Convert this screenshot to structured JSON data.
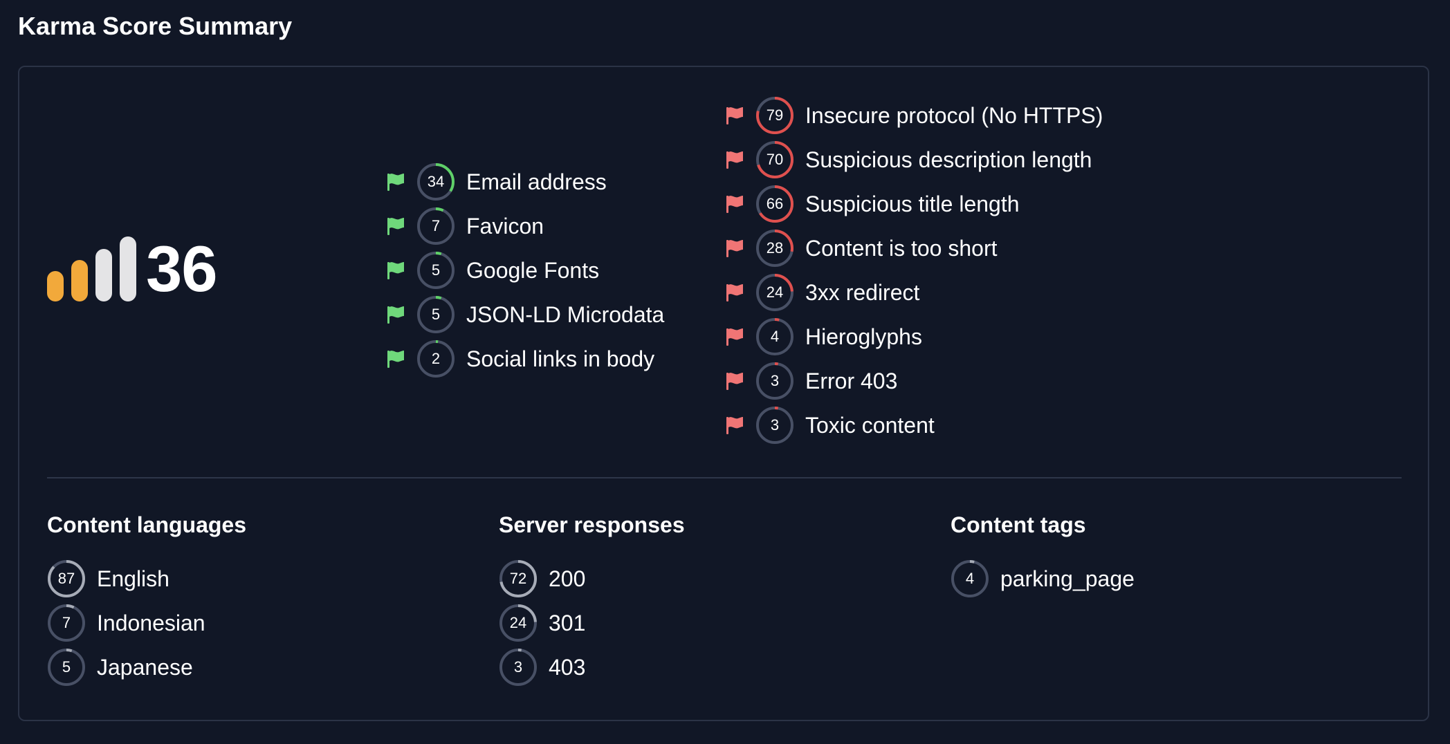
{
  "page": {
    "title": "Karma Score Summary"
  },
  "colors": {
    "background": "#111726",
    "card_border": "#2b3346",
    "ring_track": "#485065",
    "positive": "#5fd068",
    "negative": "#e0504e",
    "neutral": "#a7acb7",
    "flag_green": "#6fd87b",
    "flag_red": "#f07575",
    "bar_active": "#f2a93b",
    "bar_inactive": "#e4e4e6"
  },
  "score": {
    "value": "36",
    "bars_total": 4,
    "bars_active": 2
  },
  "positive_signals": [
    {
      "value": "34",
      "label": "Email address",
      "fraction": 0.34
    },
    {
      "value": "7",
      "label": "Favicon",
      "fraction": 0.07
    },
    {
      "value": "5",
      "label": "Google Fonts",
      "fraction": 0.05
    },
    {
      "value": "5",
      "label": "JSON-LD Microdata",
      "fraction": 0.05
    },
    {
      "value": "2",
      "label": "Social links in body",
      "fraction": 0.02
    }
  ],
  "negative_signals": [
    {
      "value": "79",
      "label": "Insecure protocol (No HTTPS)",
      "fraction": 0.79
    },
    {
      "value": "70",
      "label": "Suspicious description length",
      "fraction": 0.7
    },
    {
      "value": "66",
      "label": "Suspicious title length",
      "fraction": 0.66
    },
    {
      "value": "28",
      "label": "Content is too short",
      "fraction": 0.28
    },
    {
      "value": "24",
      "label": "3xx redirect",
      "fraction": 0.24
    },
    {
      "value": "4",
      "label": "Hieroglyphs",
      "fraction": 0.04
    },
    {
      "value": "3",
      "label": "Error 403",
      "fraction": 0.03
    },
    {
      "value": "3",
      "label": "Toxic content",
      "fraction": 0.03
    }
  ],
  "content_languages": {
    "title": "Content languages",
    "items": [
      {
        "value": "87",
        "label": "English",
        "fraction": 0.87
      },
      {
        "value": "7",
        "label": "Indonesian",
        "fraction": 0.07
      },
      {
        "value": "5",
        "label": "Japanese",
        "fraction": 0.05
      }
    ]
  },
  "server_responses": {
    "title": "Server responses",
    "items": [
      {
        "value": "72",
        "label": "200",
        "fraction": 0.72
      },
      {
        "value": "24",
        "label": "301",
        "fraction": 0.24
      },
      {
        "value": "3",
        "label": "403",
        "fraction": 0.03
      }
    ]
  },
  "content_tags": {
    "title": "Content tags",
    "items": [
      {
        "value": "4",
        "label": "parking_page",
        "fraction": 0.04
      }
    ]
  }
}
